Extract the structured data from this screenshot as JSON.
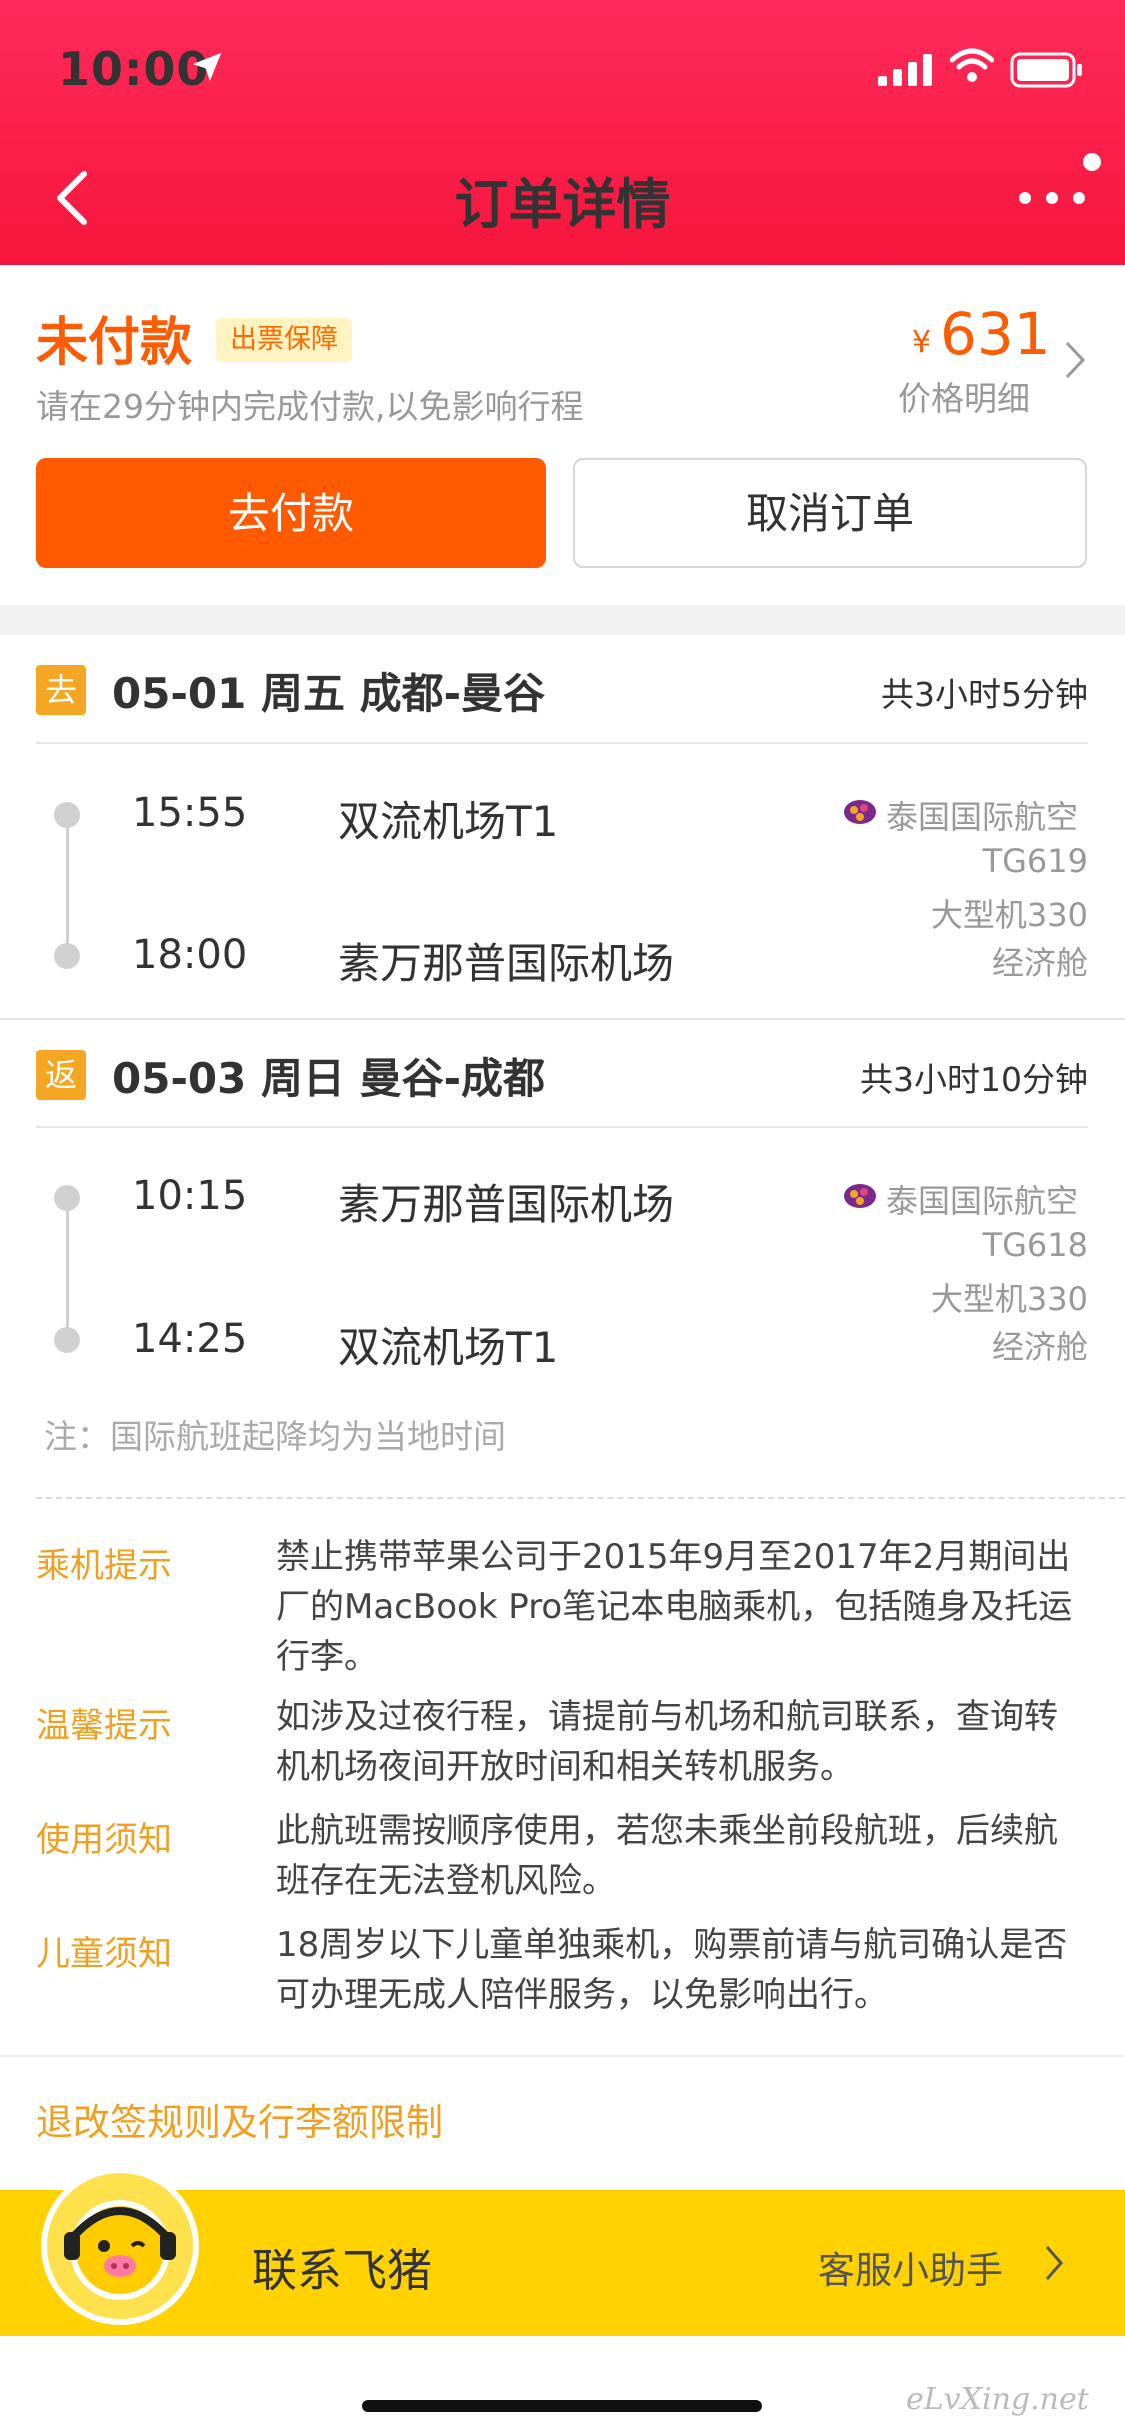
{
  "status_bar": {
    "time": "10:00"
  },
  "header": {
    "title": "订单详情"
  },
  "payment": {
    "status": "未付款",
    "badge": "出票保障",
    "tip": "请在29分钟内完成付款,以免影响行程",
    "currency": "¥",
    "price": "631",
    "price_detail": "价格明细",
    "pay_button": "去付款",
    "cancel_button": "取消订单"
  },
  "segments": [
    {
      "badge": "去",
      "route": "05-01 周五 成都-曼谷",
      "duration": "共3小时5分钟",
      "dep_time": "15:55",
      "dep_airport": "双流机场T1",
      "arr_time": "18:00",
      "arr_airport": "素万那普国际机场",
      "airline": "泰国国际航空",
      "flight_no": "TG619",
      "aircraft": "大型机330",
      "cabin": "经济舱"
    },
    {
      "badge": "返",
      "route": "05-03 周日 曼谷-成都",
      "duration": "共3小时10分钟",
      "dep_time": "10:15",
      "dep_airport": "素万那普国际机场",
      "arr_time": "14:25",
      "arr_airport": "双流机场T1",
      "airline": "泰国国际航空",
      "flight_no": "TG618",
      "aircraft": "大型机330",
      "cabin": "经济舱"
    }
  ],
  "note": "注：国际航班起降均为当地时间",
  "tips": [
    {
      "label": "乘机提示",
      "text": "禁止携带苹果公司于2015年9月至2017年2月期间出厂的MacBook Pro笔记本电脑乘机，包括随身及托运行李。"
    },
    {
      "label": "温馨提示",
      "text": "如涉及过夜行程，请提前与机场和航司联系，查询转机机场夜间开放时间和相关转机服务。"
    },
    {
      "label": "使用须知",
      "text": "此航班需按顺序使用，若您未乘坐前段航班，后续航班存在无法登机风险。"
    },
    {
      "label": "儿童须知",
      "text": "18周岁以下儿童单独乘机，购票前请与航司确认是否可办理无成人陪伴服务，以免影响出行。"
    }
  ],
  "rules_link": "退改签规则及行李额限制",
  "contact": {
    "label": "联系飞猪",
    "assistant": "客服小助手"
  },
  "watermark": "eLvXing.net",
  "colors": {
    "header": "#f6163d",
    "accent": "#ff5a00",
    "tip_label": "#f0a020",
    "contact_bar": "#ffd200"
  }
}
